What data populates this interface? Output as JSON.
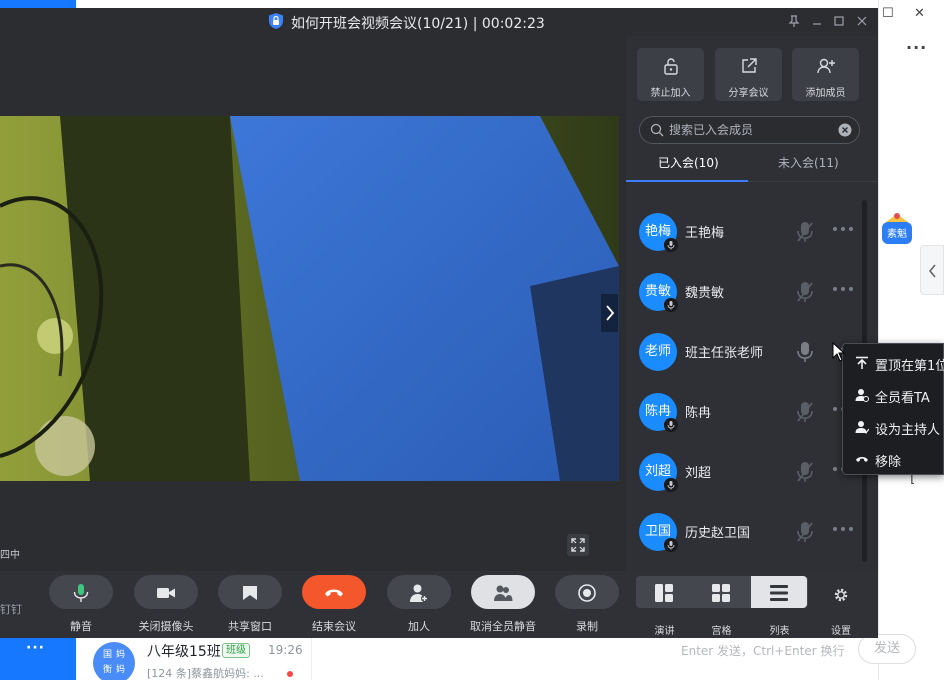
{
  "window": {
    "title": "如何开班会视频会议(10/21) | 00:02:23"
  },
  "video": {
    "status_fragment": "四中"
  },
  "panel": {
    "actions": [
      {
        "label": "禁止加入",
        "icon": "lock-icon"
      },
      {
        "label": "分享会议",
        "icon": "share-icon"
      },
      {
        "label": "添加成员",
        "icon": "add-member-icon"
      }
    ],
    "search": {
      "placeholder": "搜索已入会成员"
    },
    "tabs": [
      {
        "label": "已入会(10)",
        "active": true
      },
      {
        "label": "未入会(11)",
        "active": false
      }
    ],
    "members": [
      {
        "avatar": "艳梅",
        "name": "王艳梅",
        "mic": "muted"
      },
      {
        "avatar": "贵敏",
        "name": "魏贵敏",
        "mic": "muted"
      },
      {
        "avatar": "老师",
        "name": "班主任张老师",
        "mic": "on"
      },
      {
        "avatar": "陈冉",
        "name": "陈冉",
        "mic": "muted"
      },
      {
        "avatar": "刘超",
        "name": "刘超",
        "mic": "muted"
      },
      {
        "avatar": "卫国",
        "name": "历史赵卫国",
        "mic": "muted"
      }
    ]
  },
  "context_menu": {
    "items": [
      {
        "label": "置顶在第1位",
        "icon": "pin-top-icon"
      },
      {
        "label": "全员看TA",
        "icon": "spotlight-icon"
      },
      {
        "label": "设为主持人",
        "icon": "set-host-icon"
      },
      {
        "label": "移除",
        "icon": "remove-icon"
      }
    ]
  },
  "toolbar": {
    "cut_label": "钉钉",
    "buttons": [
      {
        "label": "静音",
        "icon": "microphone-icon"
      },
      {
        "label": "关闭摄像头",
        "icon": "camera-icon"
      },
      {
        "label": "共享窗口",
        "icon": "screen-share-icon"
      },
      {
        "label": "结束会议",
        "icon": "hang-up-icon"
      },
      {
        "label": "加人",
        "icon": "add-person-icon"
      },
      {
        "label": "取消全员静音",
        "icon": "unmute-all-icon"
      },
      {
        "label": "录制",
        "icon": "record-icon"
      }
    ],
    "layouts": [
      {
        "label": "演讲",
        "icon": "speaker-layout-icon"
      },
      {
        "label": "宫格",
        "icon": "grid-layout-icon"
      },
      {
        "label": "列表",
        "icon": "list-layout-icon",
        "active": true
      }
    ],
    "settings_label": "设置"
  },
  "background_app": {
    "chat": {
      "name": "八年级15班",
      "tag": "班级",
      "time": "19:26",
      "preview": "[124 条]蔡鑫航妈妈: ...",
      "avatar_chars": [
        "国",
        "妈",
        "衡",
        "妈"
      ]
    },
    "input_hint": "Enter 发送，Ctrl+Enter 换行",
    "send_label": "发送",
    "mascot_label": "素魁"
  },
  "colors": {
    "accent": "#1a8cff",
    "end_meeting": "#f4572b",
    "window_bg": "#222428"
  }
}
